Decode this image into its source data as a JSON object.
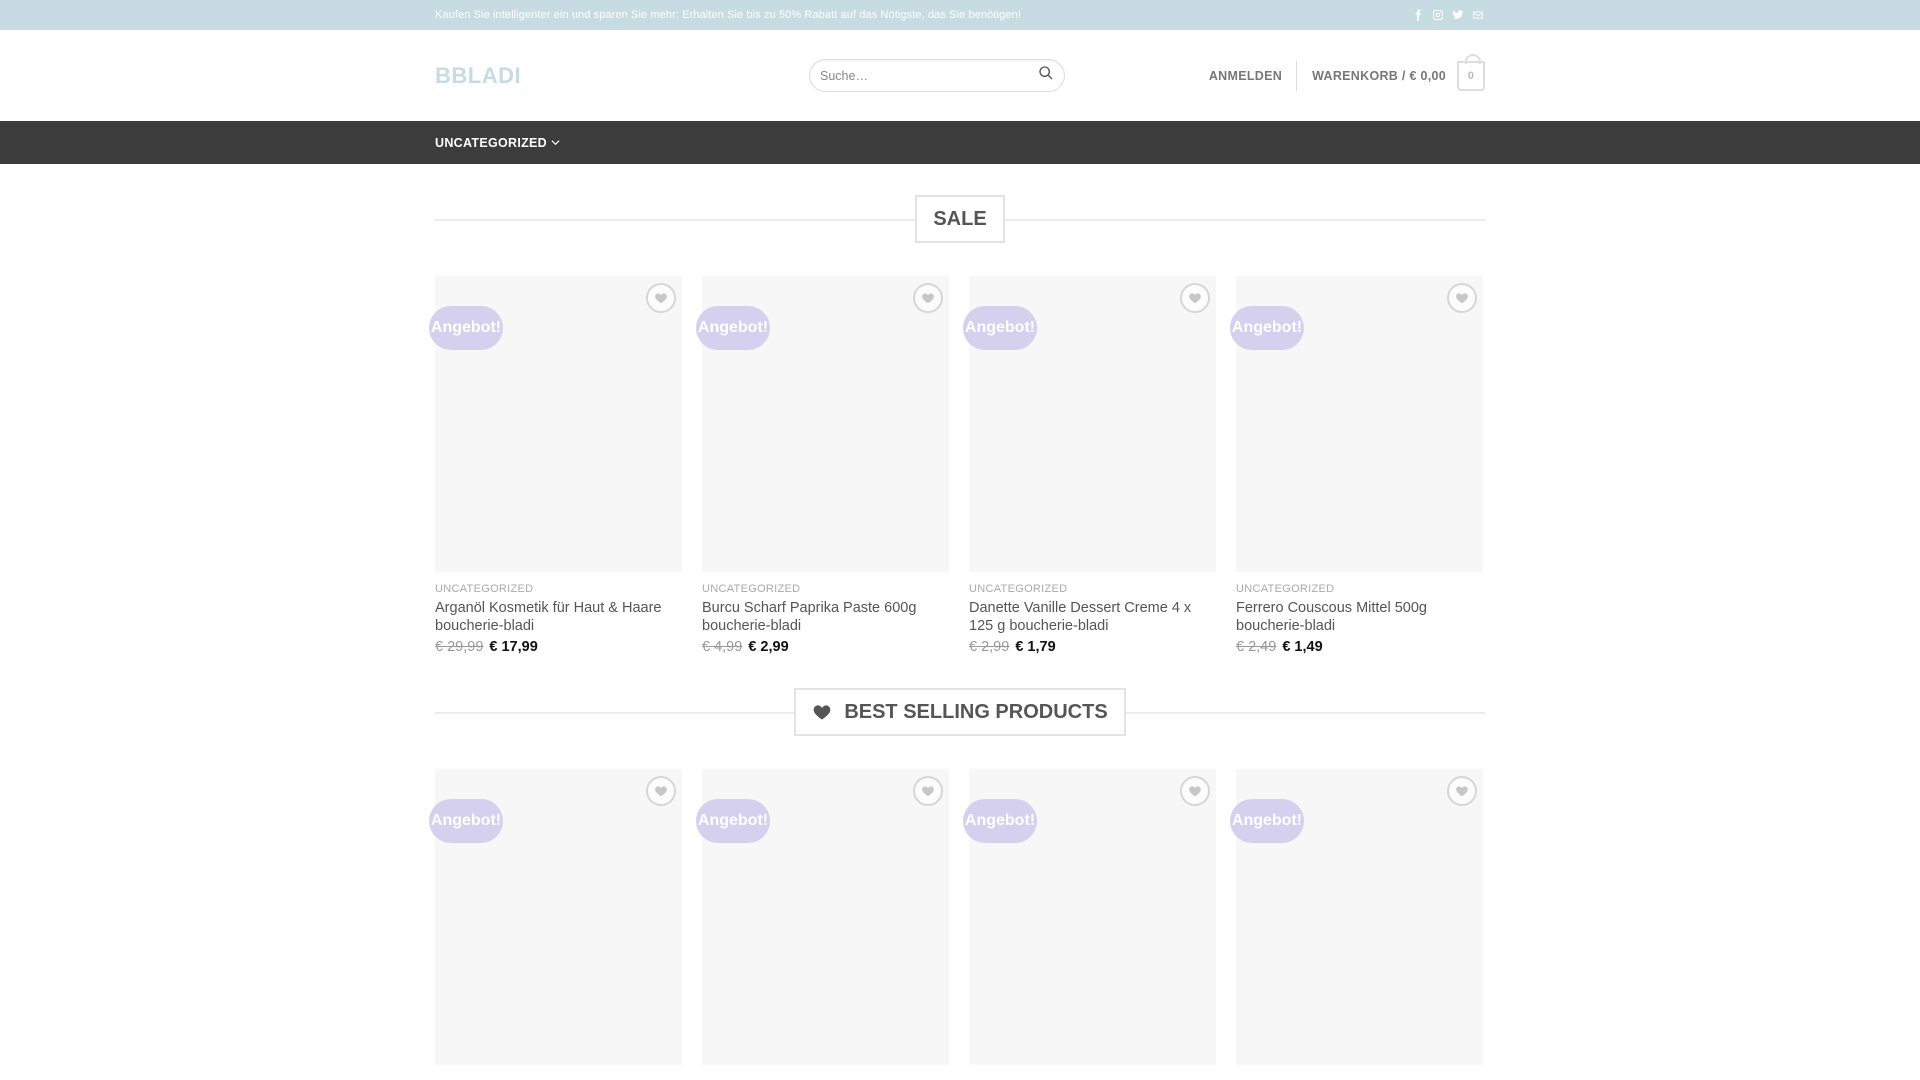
{
  "topbar": {
    "text": "Kaufen Sie intelligenter ein und sparen Sie mehr: Erhalten Sie bis zu 50% Rabatt auf das Nötigste, das Sie benötigen!",
    "social_icons": [
      "facebook-icon",
      "instagram-icon",
      "twitter-icon",
      "email-icon"
    ]
  },
  "header": {
    "logo": "BBLADI",
    "search_placeholder": "Suche…",
    "login": "ANMELDEN",
    "cart_label": "WARENKORB / € 0,00",
    "cart_count": "0"
  },
  "nav": {
    "items": [
      {
        "label": "UNCATEGORIZED"
      }
    ]
  },
  "sections": [
    {
      "title": "SALE",
      "products": [
        {
          "badge": "Angebot!",
          "category": "UNCATEGORIZED",
          "name": "Arganöl Kosmetik für Haut & Haare boucherie-bladi",
          "old_price": "€ 29,99",
          "new_price": "€ 17,99"
        },
        {
          "badge": "Angebot!",
          "category": "UNCATEGORIZED",
          "name": "Burcu Scharf Paprika Paste 600g boucherie-bladi",
          "old_price": "€ 4,99",
          "new_price": "€ 2,99"
        },
        {
          "badge": "Angebot!",
          "category": "UNCATEGORIZED",
          "name": "Danette Vanille Dessert Creme 4 x 125 g boucherie-bladi",
          "old_price": "€ 2,99",
          "new_price": "€ 1,79"
        },
        {
          "badge": "Angebot!",
          "category": "UNCATEGORIZED",
          "name": "Ferrero Couscous Mittel 500g boucherie-bladi",
          "old_price": "€ 2,49",
          "new_price": "€ 1,49"
        }
      ]
    },
    {
      "title": "BEST SELLING PRODUCTS",
      "products": [
        {
          "badge": "Angebot!"
        },
        {
          "badge": "Angebot!"
        },
        {
          "badge": "Angebot!"
        },
        {
          "badge": "Angebot!"
        }
      ]
    }
  ]
}
